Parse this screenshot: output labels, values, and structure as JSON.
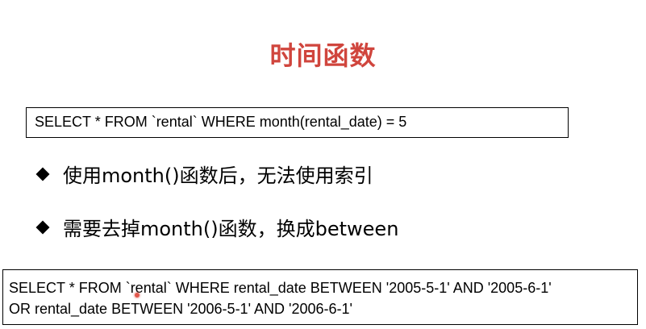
{
  "slide": {
    "title": "时间函数",
    "code_box_1": {
      "line": "SELECT * FROM `rental` WHERE month(rental_date) = 5"
    },
    "bullets": [
      {
        "text": "使用month()函数后，无法使用索引"
      },
      {
        "text": "需要去掉month()函数，换成between"
      }
    ],
    "code_box_2": {
      "lines": [
        "SELECT * FROM `rental` WHERE rental_date BETWEEN '2005-5-1' AND '2005-6-1'",
        "OR rental_date BETWEEN '2006-5-1' AND '2006-6-1'"
      ]
    }
  },
  "colors": {
    "title": "#d0453d",
    "text": "#000000",
    "cursor": "#e2574c"
  }
}
